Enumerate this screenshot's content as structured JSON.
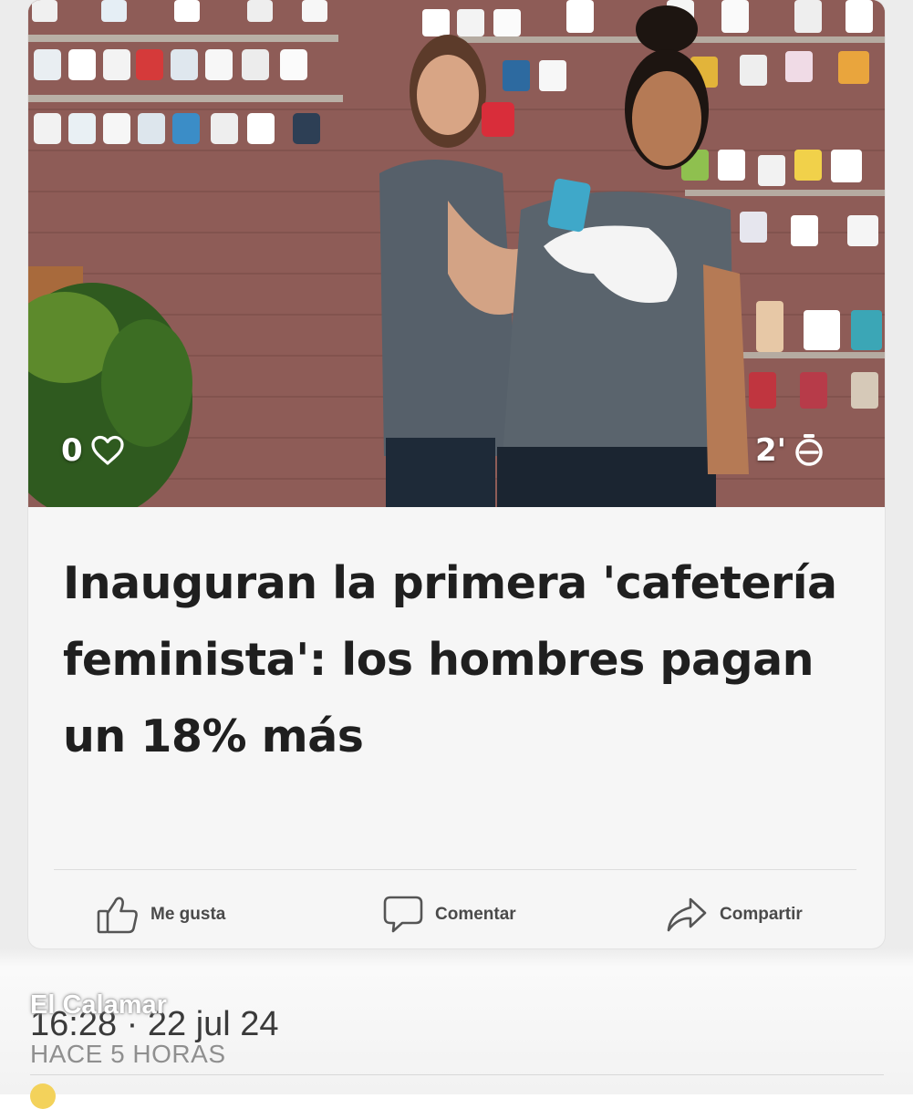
{
  "post": {
    "likes_count": "0",
    "read_time": "2'",
    "headline": "Inauguran la primera 'cafetería feminista': los hombres pagan un 18% más",
    "photo_description_icon": "photo-icon"
  },
  "actions": {
    "like_label": "Me gusta",
    "comment_label": "Comentar",
    "share_label": "Compartir"
  },
  "meta": {
    "source": "El Calamar",
    "timestamp": "16:28 · 22 jul 24",
    "relative_time": "HACE 5 HORAS"
  },
  "icons": {
    "heart": "heart-icon",
    "stopwatch": "stopwatch-icon",
    "thumbs_up": "thumbs-up-icon",
    "comment": "comment-icon",
    "share": "share-icon"
  },
  "colors": {
    "headline": "#1f1f1f",
    "action_text": "#4a4a4a",
    "card_background": "#f6f6f6",
    "meta_gray": "#8f8f8f"
  }
}
